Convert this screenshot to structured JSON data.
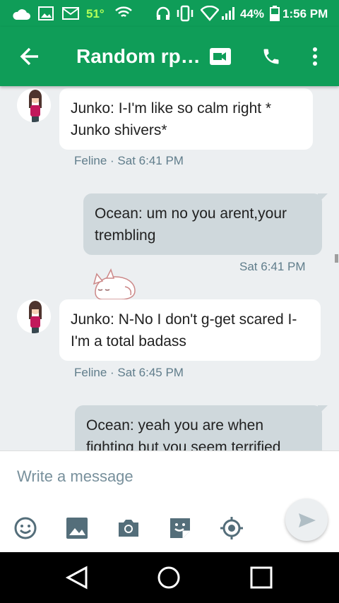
{
  "status_bar": {
    "temperature": "51°",
    "battery": "44%",
    "time": "1:56 PM"
  },
  "toolbar": {
    "title": "Random rp…"
  },
  "messages": [
    {
      "direction": "in",
      "text": "Junko: I-I'm like so calm right * Junko shivers*",
      "meta": "Feline · Sat 6:41 PM"
    },
    {
      "direction": "out",
      "text": "Ocean: um no you arent,your trembling",
      "meta": "Sat 6:41 PM"
    },
    {
      "direction": "in",
      "text": "Junko: N-No I don't g-get scared I-I'm a total badass",
      "meta": "Feline · Sat 6:45 PM"
    },
    {
      "direction": "out",
      "text": "Ocean: yeah you are when fighting but you seem terrified"
    }
  ],
  "composer": {
    "placeholder": "Write a message"
  },
  "colors": {
    "accent": "#0f9d58",
    "incoming_bubble": "#ffffff",
    "outgoing_bubble": "#cfd8dc",
    "background": "#eceff1"
  }
}
